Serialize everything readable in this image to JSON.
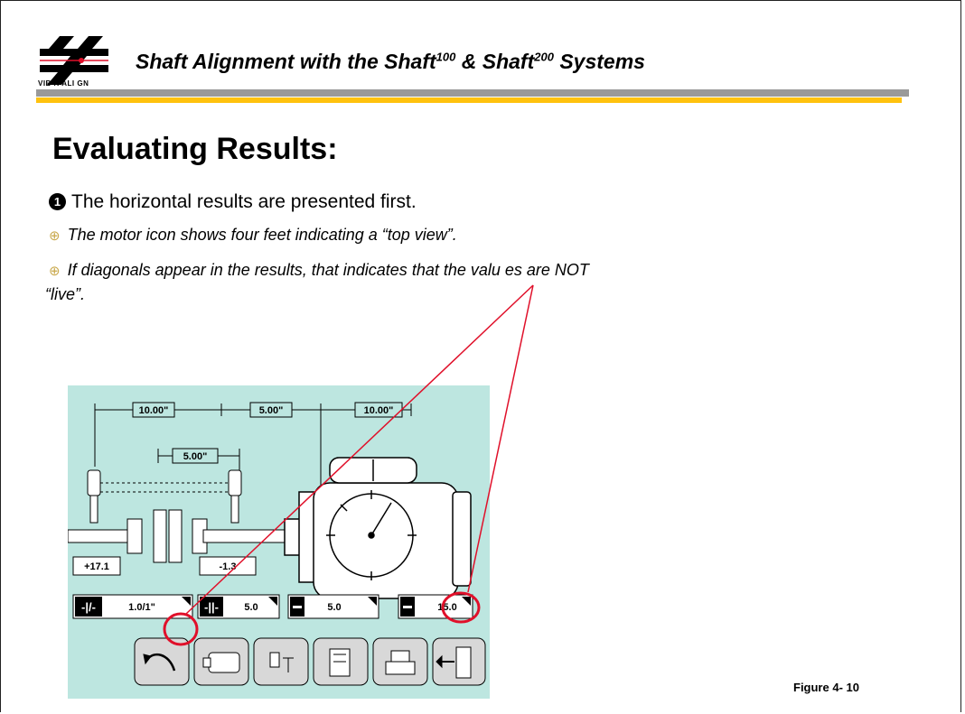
{
  "header": {
    "logo_text": "VIB R ALI GN",
    "title_part1": "Shaft Alignment with the Shaft",
    "title_sup1": "100",
    "title_part2": " & Shaft",
    "title_sup2": "200",
    "title_part3": " Systems"
  },
  "slide": {
    "heading": "Evaluating Results:",
    "bullet_number": "1",
    "bullet_main": "The horizontal results are presented first.",
    "sub_bullets": [
      "The motor icon shows four feet indicating a “top view”.",
      "If diagonals appear in the results, that indicates that the valu es are NOT"
    ],
    "sub_bullet_continuation": "“live”.",
    "figure_caption": "Figure 4- 10"
  },
  "device_screen": {
    "background_color": "#BDE6E0",
    "dimensions": {
      "left_span": "10.00\"",
      "middle_span": "5.00\"",
      "right_span": "10.00\"",
      "lower_span": "5.00\""
    },
    "foot_values": {
      "left": "+17.1",
      "right": "-1.3"
    },
    "result_values": [
      {
        "icon": "angularity-icon",
        "value": "1.0/1\""
      },
      {
        "icon": "offset-icon",
        "value": "5.0"
      },
      {
        "icon": "dash-icon",
        "value": "5.0"
      },
      {
        "icon": "dash-icon",
        "value": "15.0"
      }
    ],
    "toolbar_buttons": [
      "undo-arrow-icon",
      "motor-icon",
      "measure-icon",
      "adjust-icon",
      "printer-icon",
      "exit-icon"
    ]
  },
  "colors": {
    "accent_gold": "#FFC20E",
    "rule_gray": "#999999",
    "annotation_red": "#E0102A"
  }
}
